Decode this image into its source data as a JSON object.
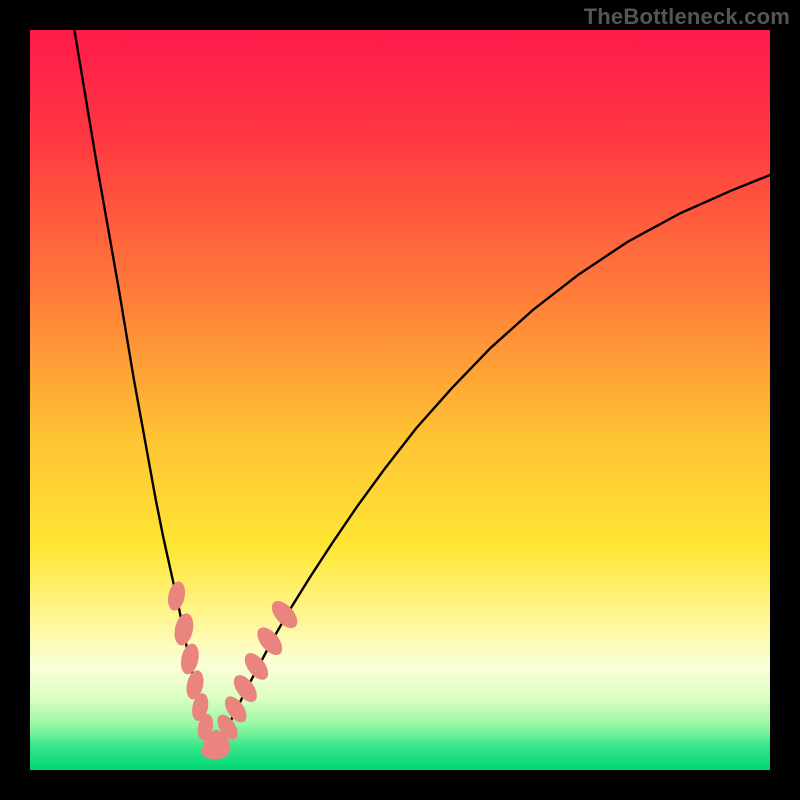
{
  "watermark": "TheBottleneck.com",
  "colors": {
    "frame": "#000000",
    "curve": "#000000",
    "marker_fill": "#e9847e",
    "marker_stroke": "#e9847e"
  },
  "chart_data": {
    "type": "line",
    "title": "",
    "xlabel": "",
    "ylabel": "",
    "xlim": [
      0,
      100
    ],
    "ylim": [
      0,
      100
    ],
    "gradient_stops": [
      {
        "offset": 0.0,
        "color": "#ff1a4b"
      },
      {
        "offset": 0.15,
        "color": "#ff3940"
      },
      {
        "offset": 0.35,
        "color": "#ff7a3a"
      },
      {
        "offset": 0.55,
        "color": "#ffc334"
      },
      {
        "offset": 0.7,
        "color": "#ffe634"
      },
      {
        "offset": 0.8,
        "color": "#fff79a"
      },
      {
        "offset": 0.86,
        "color": "#faffd8"
      },
      {
        "offset": 0.905,
        "color": "#d9ffc0"
      },
      {
        "offset": 0.94,
        "color": "#93f7a4"
      },
      {
        "offset": 0.97,
        "color": "#34e58a"
      },
      {
        "offset": 1.0,
        "color": "#00d774"
      }
    ],
    "series": [
      {
        "name": "left-branch",
        "x": [
          6.0,
          7.5,
          9.0,
          10.5,
          12.0,
          13.0,
          14.0,
          15.0,
          16.0,
          17.0,
          18.0,
          19.0,
          20.0,
          20.8,
          21.5,
          22.2,
          22.8,
          23.3,
          23.8,
          24.2,
          24.6,
          25.0
        ],
        "y": [
          100.0,
          91.0,
          82.0,
          73.5,
          65.0,
          59.0,
          53.0,
          47.5,
          42.0,
          36.5,
          31.5,
          27.0,
          22.5,
          18.5,
          15.0,
          12.0,
          9.5,
          7.5,
          5.8,
          4.4,
          3.3,
          2.5
        ]
      },
      {
        "name": "right-branch",
        "x": [
          25.0,
          25.6,
          26.3,
          27.2,
          28.3,
          29.6,
          31.2,
          33.0,
          35.2,
          37.8,
          40.8,
          44.2,
          48.0,
          52.2,
          57.0,
          62.2,
          68.0,
          74.2,
          80.8,
          87.8,
          95.0,
          100.0
        ],
        "y": [
          2.5,
          3.6,
          5.0,
          6.8,
          9.0,
          11.6,
          14.6,
          18.0,
          21.8,
          26.0,
          30.6,
          35.6,
          40.8,
          46.2,
          51.6,
          57.0,
          62.2,
          67.0,
          71.4,
          75.2,
          78.4,
          80.4
        ]
      }
    ],
    "markers": {
      "name": "highlighted-points",
      "points": [
        {
          "x": 19.8,
          "y": 23.5,
          "r": 2.0
        },
        {
          "x": 20.8,
          "y": 19.0,
          "r": 2.2
        },
        {
          "x": 21.6,
          "y": 15.0,
          "r": 2.1
        },
        {
          "x": 22.3,
          "y": 11.5,
          "r": 2.0
        },
        {
          "x": 23.0,
          "y": 8.5,
          "r": 1.9
        },
        {
          "x": 23.7,
          "y": 5.8,
          "r": 1.8
        },
        {
          "x": 24.4,
          "y": 3.6,
          "r": 1.7
        },
        {
          "x": 25.0,
          "y": 2.5,
          "r": 1.9
        },
        {
          "x": 25.8,
          "y": 3.8,
          "r": 1.8
        },
        {
          "x": 26.7,
          "y": 5.8,
          "r": 1.9
        },
        {
          "x": 27.8,
          "y": 8.2,
          "r": 2.0
        },
        {
          "x": 29.1,
          "y": 11.0,
          "r": 2.1
        },
        {
          "x": 30.6,
          "y": 14.0,
          "r": 2.1
        },
        {
          "x": 32.4,
          "y": 17.4,
          "r": 2.2
        },
        {
          "x": 34.4,
          "y": 21.0,
          "r": 2.2
        }
      ]
    }
  }
}
